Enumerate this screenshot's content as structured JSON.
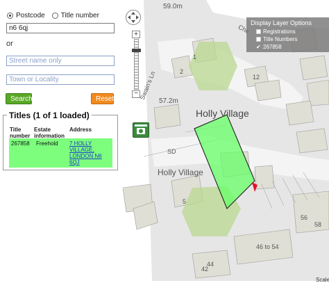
{
  "search": {
    "mode_postcode": "Postcode",
    "mode_title": "Title number",
    "postcode_value": "n6 6qj",
    "or_label": "or",
    "street_placeholder": "Street name only",
    "town_placeholder": "Town or Locality",
    "search_label": "Search",
    "reset_label": "Reset"
  },
  "titles": {
    "heading": "Titles (1 of 1 loaded)",
    "columns": [
      "Title number",
      "Estate information",
      "Address"
    ],
    "rows": [
      {
        "title_number": "267858",
        "estate": "Freehold",
        "address": "7 HOLLY VILLAGE, LONDON N6 6QJ"
      }
    ]
  },
  "layers": {
    "title": "Display Layer Options",
    "items": [
      {
        "label": "Registrations",
        "checked": false
      },
      {
        "label": "Title Numbers",
        "checked": false
      },
      {
        "label": "267858",
        "checked": true
      }
    ]
  },
  "map": {
    "spot_heights": [
      "59.0m",
      "57.2m"
    ],
    "place_names": [
      "Holly Village",
      "Holly Village"
    ],
    "street_names": [
      "Swain's Ln",
      "Che"
    ],
    "plot_numbers": [
      "2",
      "1",
      "12",
      "SD",
      "5",
      "56",
      "58",
      "46 to 54",
      "42",
      "44"
    ],
    "scale_label": "Scale"
  },
  "colors": {
    "search_button": "#5aa826",
    "reset_button": "#f28a1e",
    "highlight_title": "#7dff7d",
    "title_plot_fill": "#66ff66",
    "boundary_marker": "#e8102a"
  },
  "icons": [
    "pan-control-icon",
    "zoom-in-icon",
    "zoom-out-icon",
    "camera-icon",
    "checkbox-icon",
    "checkmark-icon",
    "location-pin-icon"
  ]
}
